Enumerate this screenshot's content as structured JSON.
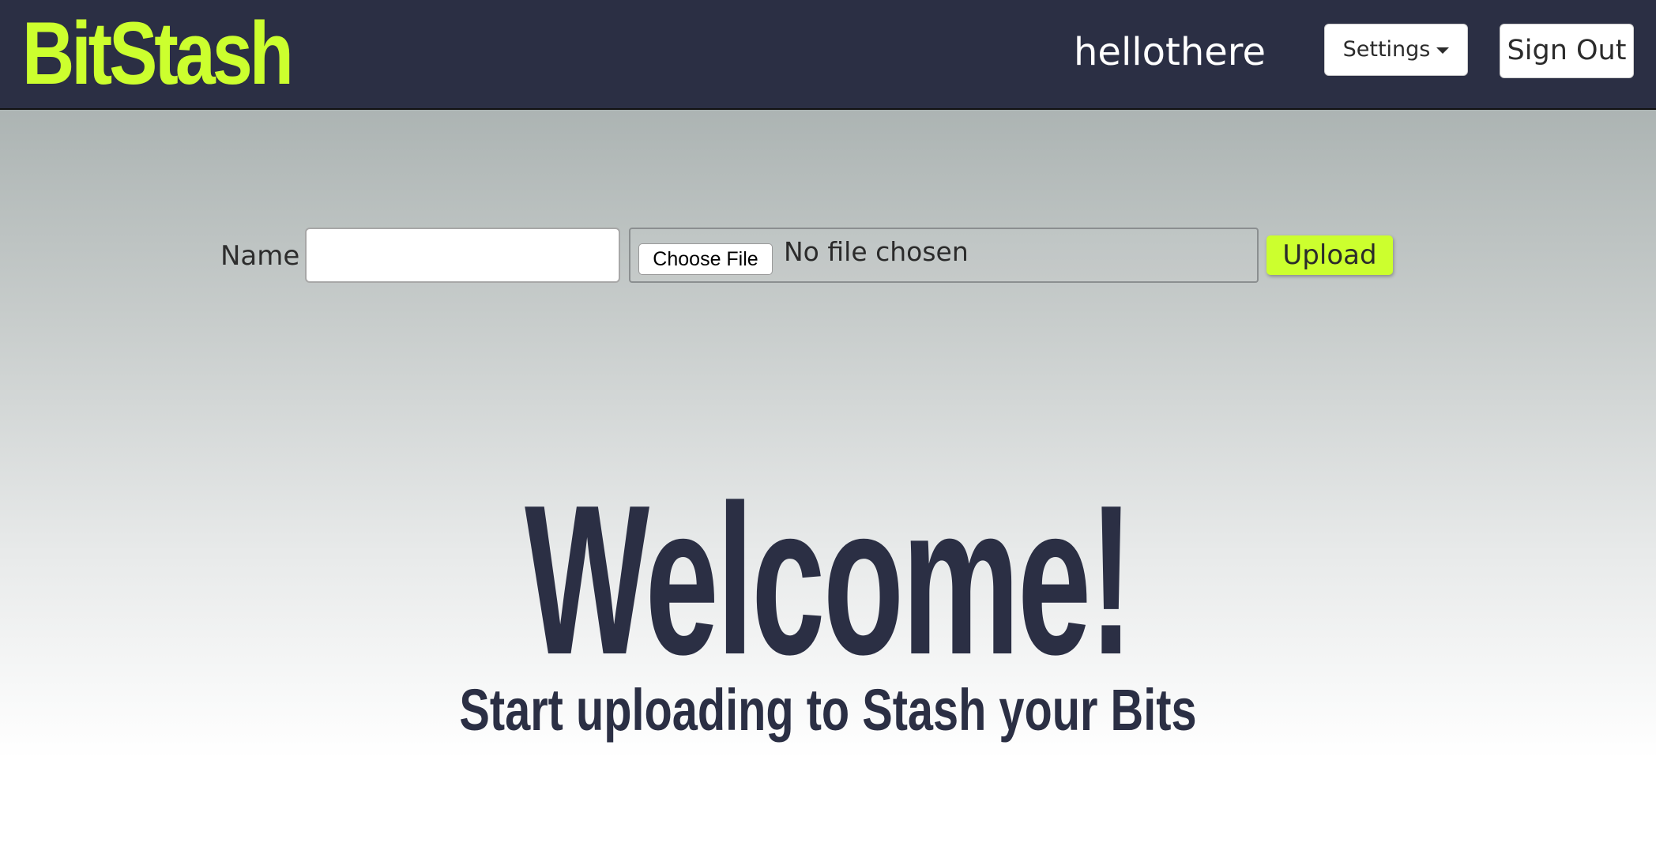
{
  "header": {
    "brand": "BitStash",
    "username": "hellothere",
    "settings_label": "Settings",
    "signout_label": "Sign Out"
  },
  "upload_form": {
    "name_label": "Name",
    "name_value": "",
    "choose_file_label": "Choose File",
    "file_status": "No file chosen",
    "upload_label": "Upload"
  },
  "hero": {
    "title": "Welcome!",
    "subtitle": "Start uploading to Stash your Bits"
  },
  "colors": {
    "navbar_bg": "#2b2f44",
    "brand_accent": "#ccff2e",
    "hero_text": "#2b2f44"
  },
  "icons": {
    "settings_caret": "caret-down-icon"
  }
}
